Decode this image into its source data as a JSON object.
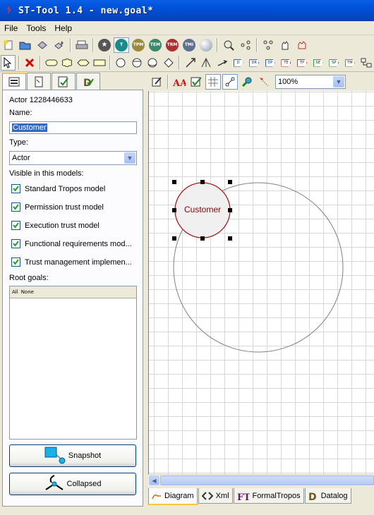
{
  "window": {
    "title": "ST-Tool 1.4 - new.goal*"
  },
  "menu": {
    "items": [
      "File",
      "Tools",
      "Help"
    ]
  },
  "toolbar_ring_labels": [
    "T",
    "TPM",
    "TEM",
    "TRM",
    "TMI"
  ],
  "toolbar_tag_labels": [
    "D",
    "DR",
    "DP",
    "TE",
    "TP",
    "SE",
    "SP",
    "TM"
  ],
  "left_panel": {
    "actor_id": "Actor 1228446633",
    "name_label": "Name:",
    "name_value": "Customer",
    "type_label": "Type:",
    "type_value": "Actor",
    "visible_label": "Visible in this models:",
    "models": [
      {
        "label": "Standard Tropos model",
        "checked": true
      },
      {
        "label": "Permission trust model",
        "checked": true
      },
      {
        "label": "Execution trust model",
        "checked": true
      },
      {
        "label": "Functional requirements mod...",
        "checked": true
      },
      {
        "label": "Trust management implemen...",
        "checked": true
      }
    ],
    "root_goals_label": "Root goals:",
    "root_goals_header": [
      "All",
      "None"
    ],
    "snapshot_label": "Snapshot",
    "collapsed_label": "Collapsed"
  },
  "editor": {
    "zoom_value": "100%",
    "actor_label": "Customer",
    "colors": {
      "actor_fill": "#f0f0f0",
      "actor_stroke": "#a01010",
      "actor_text": "#8b0000",
      "boundary_stroke": "#808080"
    }
  },
  "bottom_tabs": [
    {
      "label": "Diagram",
      "icon": "diagram-icon"
    },
    {
      "label": "Xml",
      "icon": "xml-icon"
    },
    {
      "label": "FormalTropos",
      "icon": "ft-icon"
    },
    {
      "label": "Datalog",
      "icon": "datalog-icon"
    }
  ]
}
